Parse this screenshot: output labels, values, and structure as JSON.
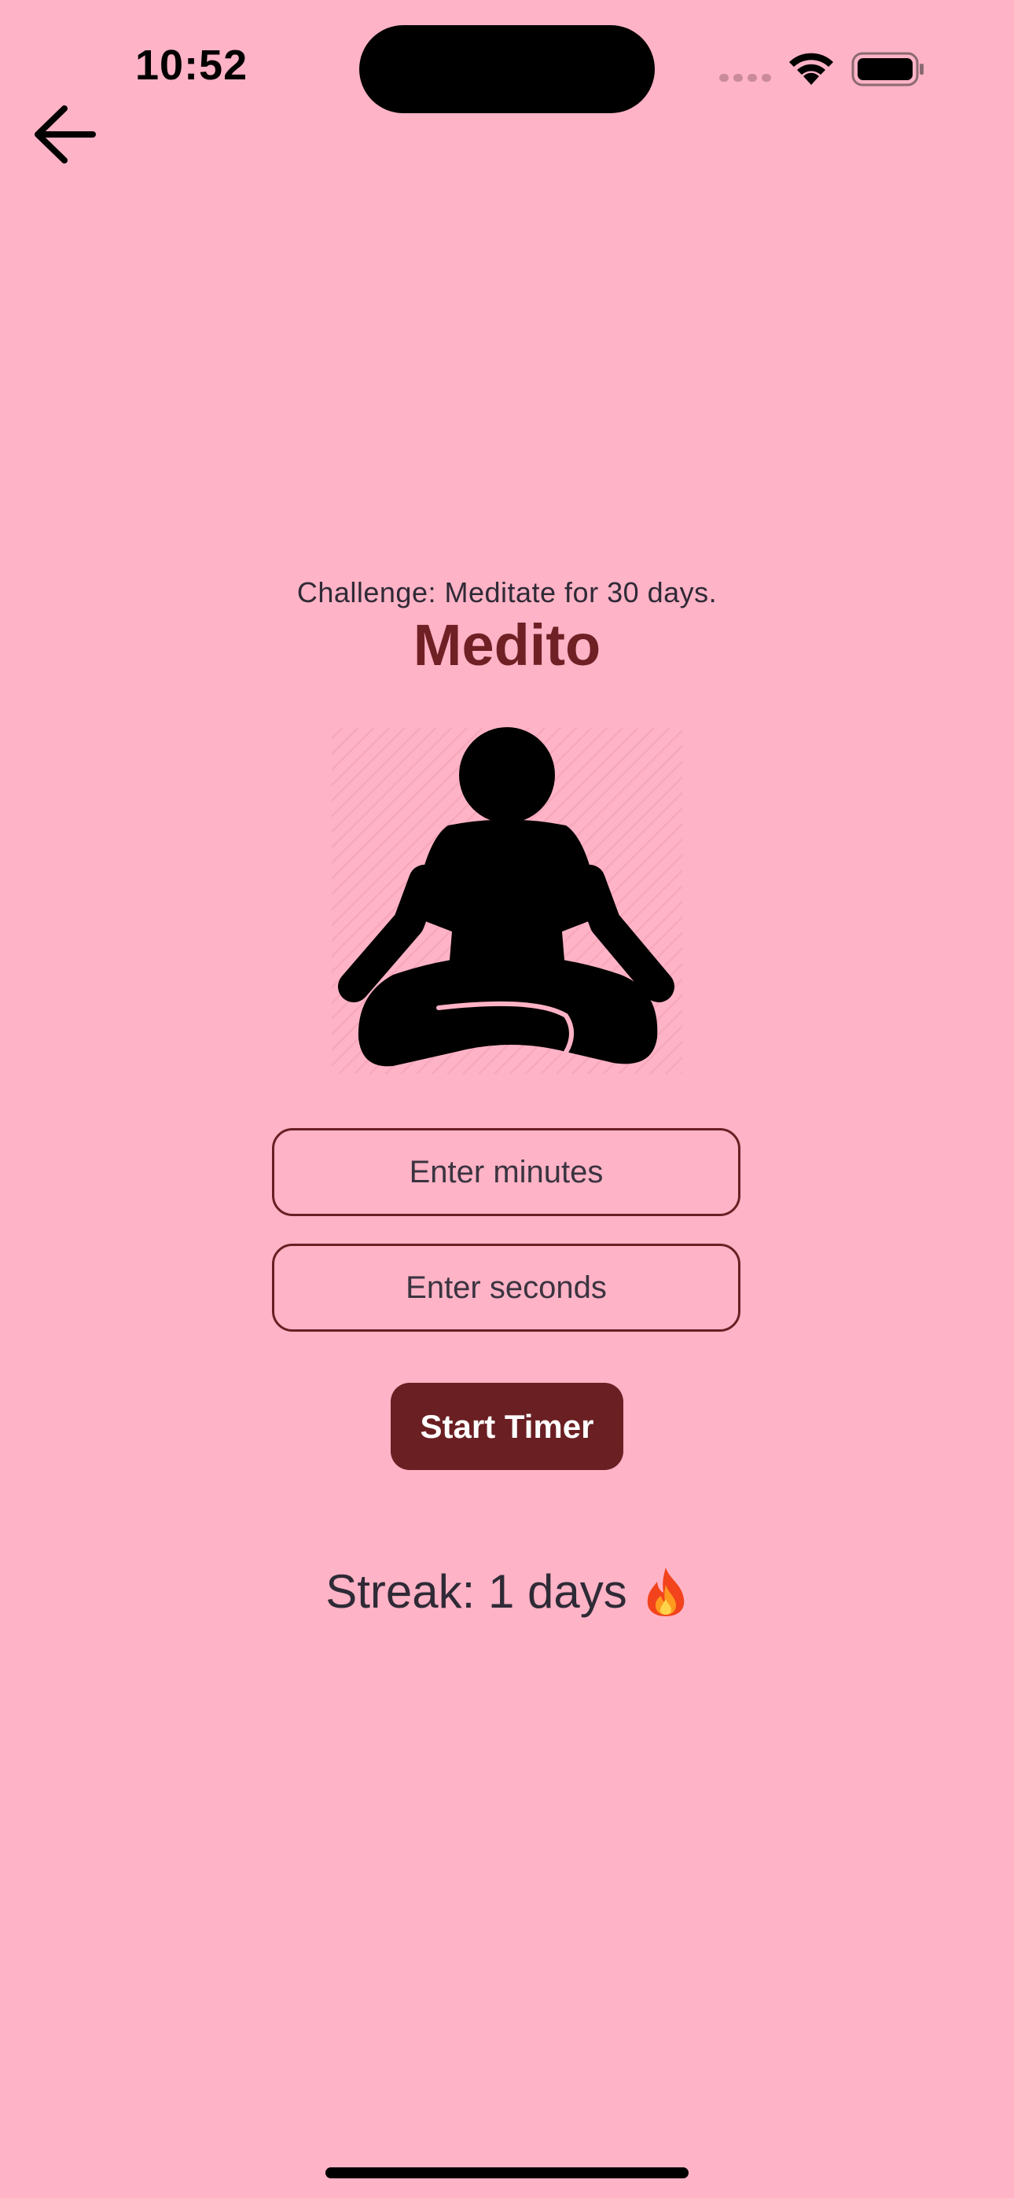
{
  "status_bar": {
    "time": "10:52"
  },
  "nav": {
    "back_icon": "arrow-left-icon"
  },
  "main": {
    "challenge": "Challenge: Meditate for 30 days.",
    "title": "Medito",
    "figure_icon": "meditation-person-icon",
    "minutes_input": {
      "value": "",
      "placeholder": "Enter minutes"
    },
    "seconds_input": {
      "value": "",
      "placeholder": "Enter seconds"
    },
    "start_button_label": "Start Timer",
    "streak_text": "Streak: 1 days",
    "streak_icon": "fire-icon"
  },
  "colors": {
    "background": "#ffb3c6",
    "accent": "#6a1f22",
    "title": "#6e2024",
    "text": "#2e2a36"
  }
}
